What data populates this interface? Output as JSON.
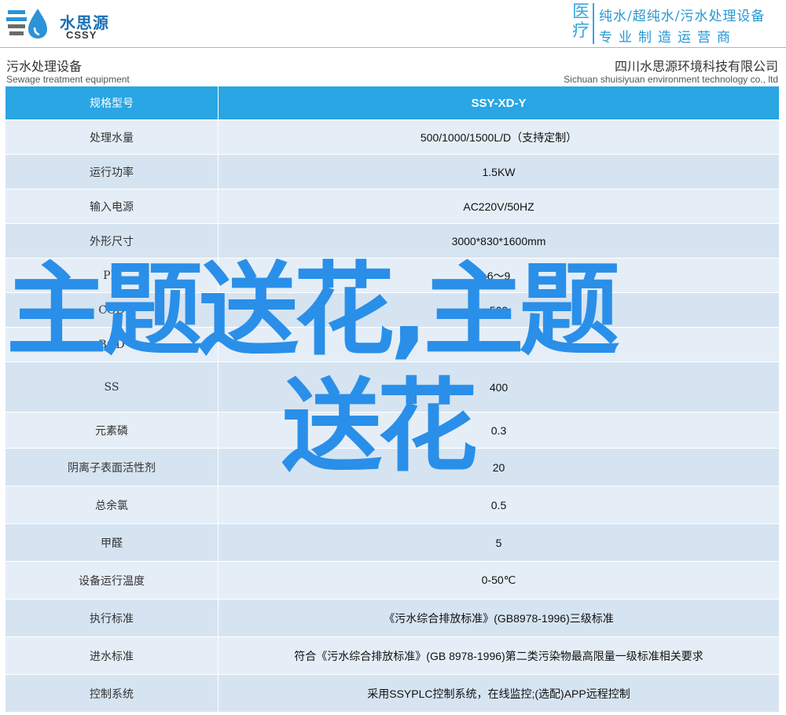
{
  "header": {
    "logo_cn": "水思源",
    "logo_en": "CSSY",
    "vertical_label_1": "医",
    "vertical_label_2": "疗",
    "slogan_line1": "纯水/超纯水/污水处理设备",
    "slogan_line2": "专业制造运营商",
    "brand_color": "#1a6fb3",
    "accent_color": "#29a6e3"
  },
  "subheader": {
    "left_cn": "污水处理设备",
    "left_en": "Sewage treatment equipment",
    "right_cn": "四川水思源环境科技有限公司",
    "right_en": "Sichuan shuisiyuan environment technology co., ltd"
  },
  "table": {
    "header": {
      "label": "规格型号",
      "value": "SSY-XD-Y"
    },
    "rows": [
      {
        "label": "处理水量",
        "value": "500/1000/1500L/D（支持定制）"
      },
      {
        "label": "运行功率",
        "value": "1.5KW"
      },
      {
        "label": "输入电源",
        "value": "AC220V/50HZ"
      },
      {
        "label": "外形尺寸",
        "value": "3000*830*1600mm"
      },
      {
        "label": "PH",
        "value": "6～9"
      },
      {
        "label": "COD",
        "value": "500"
      },
      {
        "label": "BOD",
        "value": "300"
      },
      {
        "label": "SS",
        "value": "400"
      },
      {
        "label": "元素磷",
        "value": "0.3"
      },
      {
        "label": "阴离子表面活性剂",
        "value": "20"
      },
      {
        "label": "总余氯",
        "value": "0.5"
      },
      {
        "label": "甲醛",
        "value": "5"
      },
      {
        "label": "设备运行温度",
        "value": "0-50℃"
      },
      {
        "label": "执行标准",
        "value": "《污水综合排放标准》(GB8978-1996)三级标准"
      },
      {
        "label": "进水标准",
        "value": "符合《污水综合排放标准》(GB 8978-1996)第二类污染物最高限量一级标准相关要求"
      },
      {
        "label": "控制系统",
        "value": "采用SSYPLC控制系统，在线监控;(选配)APP远程控制"
      }
    ]
  },
  "overlay": {
    "line1": "主题送花,主题",
    "line2": "送花",
    "color": "#2a8fe8"
  }
}
